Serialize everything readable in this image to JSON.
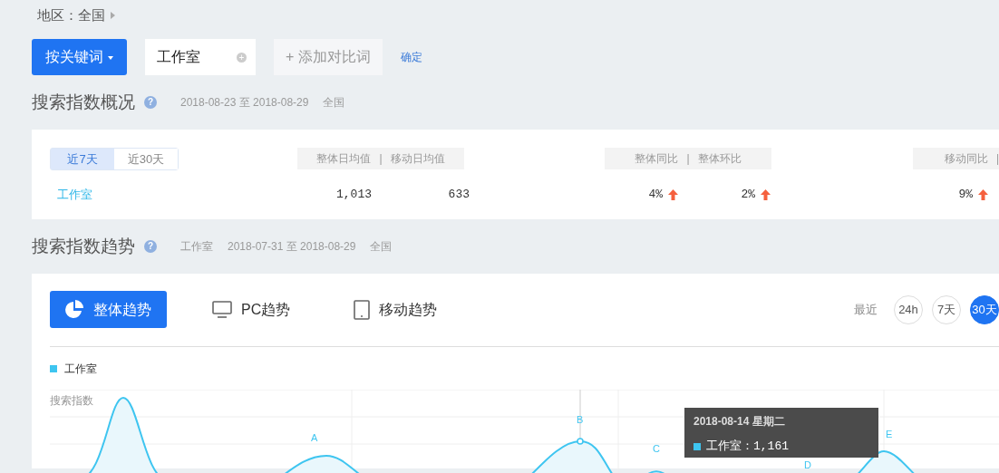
{
  "region": {
    "label": "地区：全国"
  },
  "search_bar": {
    "mode_button": "按关键词",
    "keyword": "工作室",
    "add_compare": "添加对比词",
    "add_icon": "+",
    "confirm": "确定"
  },
  "overview": {
    "title": "搜索指数概况",
    "help_icon": "?",
    "date_range": "2018-08-23 至 2018-08-29",
    "area": "全国",
    "tabs": [
      {
        "label": "近7天",
        "selected": true
      },
      {
        "label": "近30天",
        "selected": false
      }
    ],
    "header_groups": [
      {
        "labels": [
          "整体日均值",
          "移动日均值"
        ],
        "separator": "|"
      },
      {
        "labels": [
          "整体同比",
          "整体环比"
        ],
        "separator": "|"
      },
      {
        "labels": [
          "移动同比"
        ],
        "separator": "|"
      }
    ],
    "row": {
      "keyword": "工作室",
      "groups": [
        [
          {
            "value": "1,013"
          },
          {
            "value": "633"
          }
        ],
        [
          {
            "value": "4%",
            "kind": "change",
            "rising": true
          },
          {
            "value": "2%",
            "kind": "change",
            "rising": true
          }
        ],
        [
          {
            "value": "9%",
            "kind": "change",
            "rising": true
          }
        ]
      ]
    }
  },
  "trend": {
    "title": "搜索指数趋势",
    "help_icon": "?",
    "keyword": "工作室",
    "date_range": "2018-07-31 至 2018-08-29",
    "area": "全国",
    "views": [
      {
        "label": "整体趋势",
        "selected": true
      },
      {
        "label": "PC趋势",
        "selected": false
      },
      {
        "label": "移动趋势",
        "selected": false
      }
    ],
    "range_label": "最近",
    "ranges": [
      {
        "label": "24h",
        "selected": false
      },
      {
        "label": "7天",
        "selected": false
      },
      {
        "label": "30天",
        "selected": true
      }
    ],
    "legend": [
      {
        "name": "工作室",
        "color": "#3ec5f0"
      }
    ],
    "chart": {
      "ylabel": "搜索指数",
      "annotations": [
        "A",
        "B",
        "C",
        "D",
        "E"
      ],
      "tooltip": {
        "date": "2018-08-14 星期二",
        "series": "工作室",
        "delimiter": "：",
        "value": "1,161"
      }
    }
  }
}
